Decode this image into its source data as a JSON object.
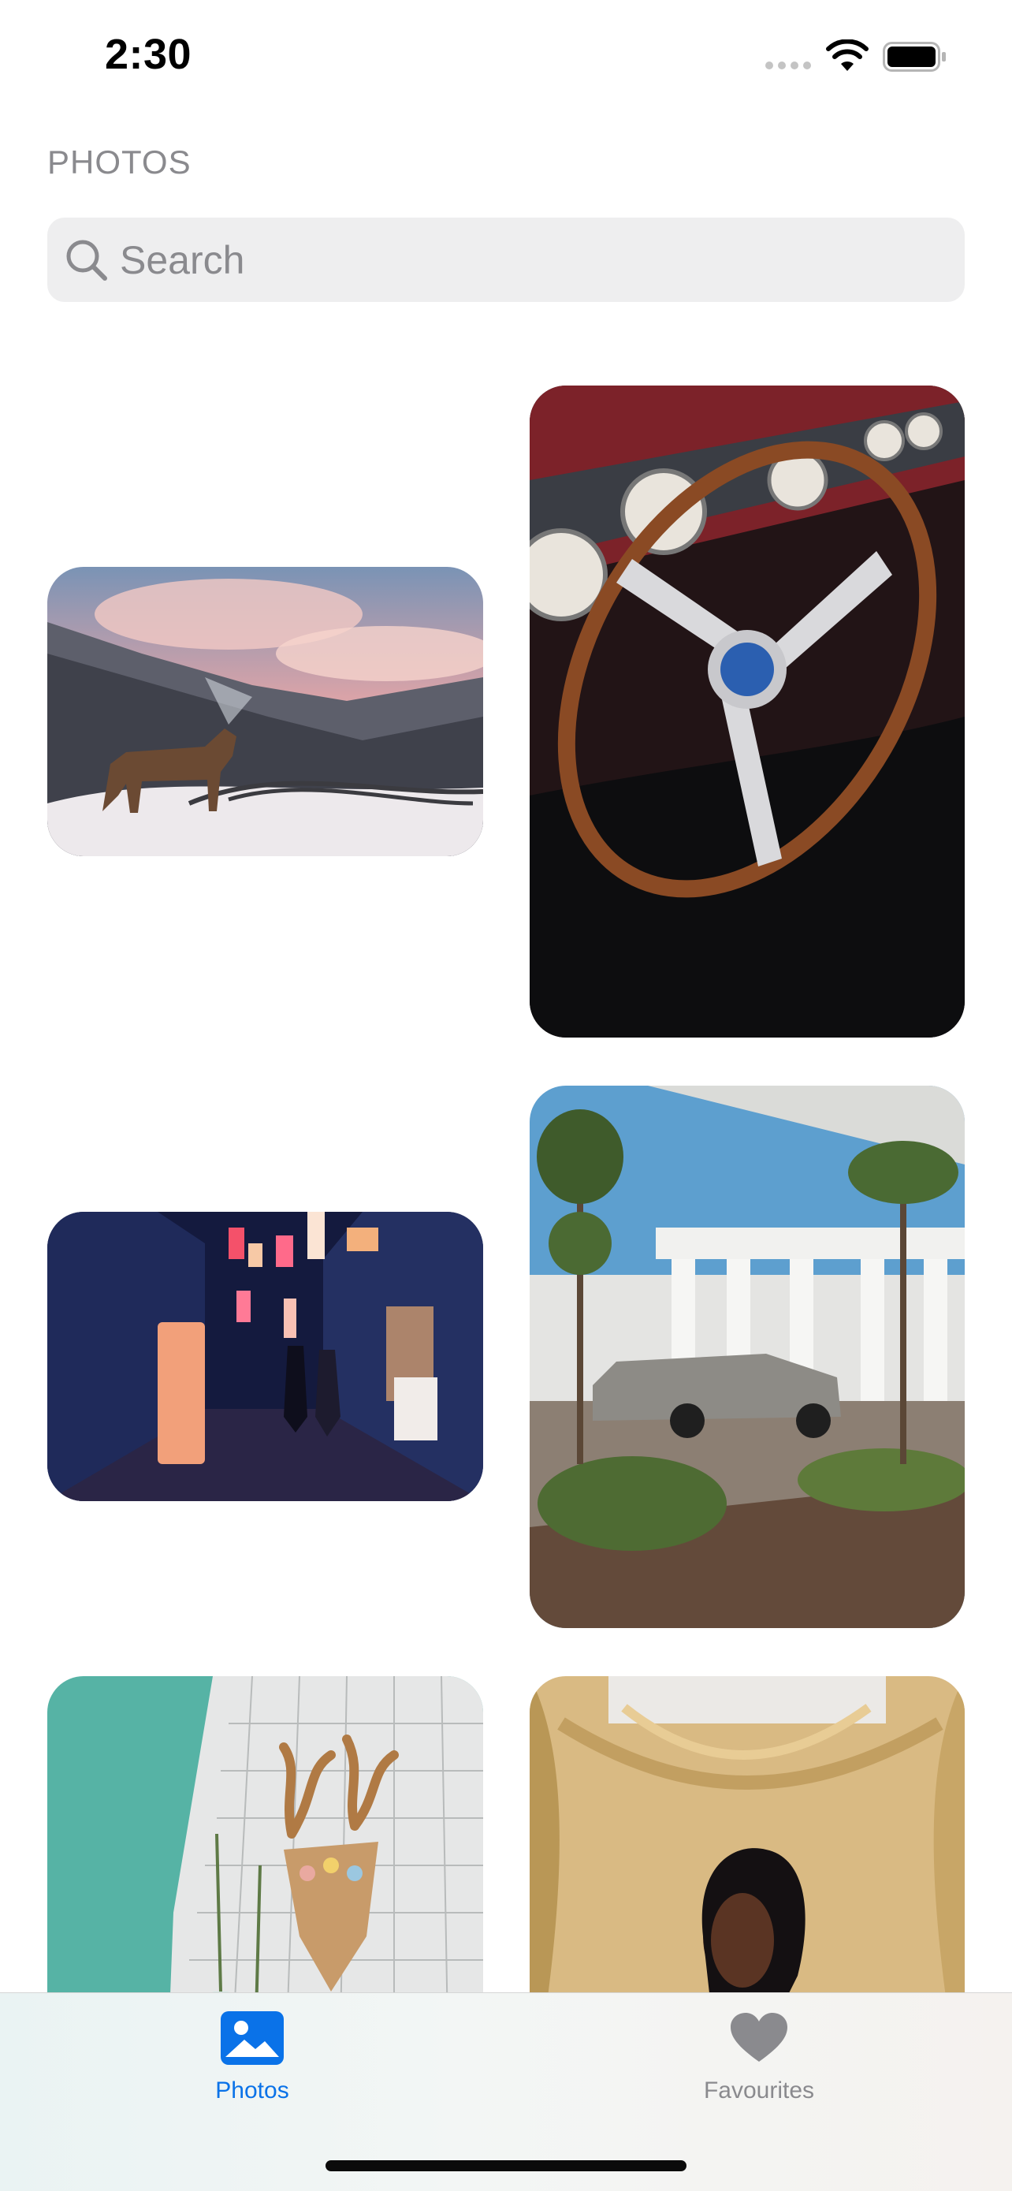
{
  "status_bar": {
    "time": "2:30",
    "signal_icon": "cellular-signal-icon",
    "wifi_icon": "wifi-icon",
    "battery_icon": "battery-icon"
  },
  "header": {
    "section_label": "PHOTOS"
  },
  "search": {
    "placeholder": "Search",
    "value": "",
    "icon": "magnifying-glass-icon"
  },
  "photos": [
    {
      "subject": "wolf-on-snowy-mountain"
    },
    {
      "subject": "vintage-car-steering-wheel"
    },
    {
      "subject": "neon-alley-at-night"
    },
    {
      "subject": "car-in-modern-courtyard"
    },
    {
      "subject": "lace-sweater-with-deer-figure"
    },
    {
      "subject": "woman-in-front-of-golden-drape"
    }
  ],
  "tab_bar": {
    "tabs": [
      {
        "label": "Photos",
        "icon": "photo-icon",
        "selected": true
      },
      {
        "label": "Favourites",
        "icon": "heart-icon",
        "selected": false
      }
    ],
    "colors": {
      "active": "#0a72e8",
      "inactive": "#8a8a8e"
    }
  }
}
